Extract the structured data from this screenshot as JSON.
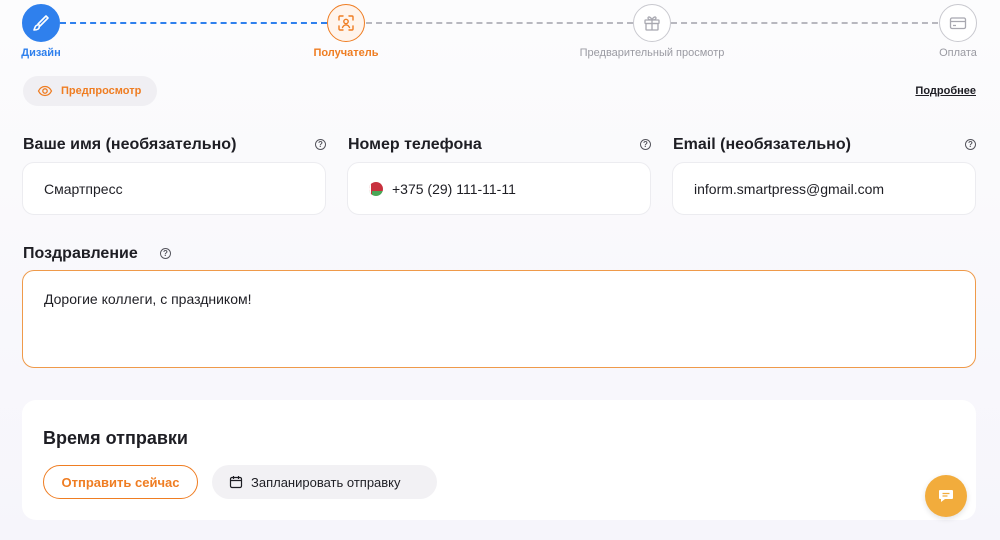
{
  "stepper": {
    "steps": [
      {
        "label": "Дизайн",
        "state": "done",
        "icon": "brush-icon"
      },
      {
        "label": "Получатель",
        "state": "active",
        "icon": "user-scan-icon"
      },
      {
        "label": "Предварительный просмотр",
        "state": "pending",
        "icon": "gift-icon"
      },
      {
        "label": "Оплата",
        "state": "pending",
        "icon": "card-icon"
      }
    ]
  },
  "preview": {
    "label": "Предпросмотр",
    "icon": "eye-icon"
  },
  "more_link": "Подробнее",
  "fields": {
    "name": {
      "label": "Ваше имя (необязательно)",
      "value": "Смартпресс"
    },
    "phone": {
      "label": "Номер телефона",
      "value": "+375 (29) 111-11-11",
      "flag": "BY"
    },
    "email": {
      "label": "Email (необязательно)",
      "value": "inform.smartpress@gmail.com"
    },
    "greeting": {
      "label": "Поздравление",
      "value": "Дорогие коллеги, с праздником!"
    }
  },
  "send_time": {
    "title": "Время отправки",
    "send_now": "Отправить сейчас",
    "schedule": "Запланировать отправку"
  },
  "help_glyph": "?",
  "colors": {
    "accent": "#ef7d22",
    "done": "#2f80ed",
    "fab": "#f2ac3c"
  }
}
